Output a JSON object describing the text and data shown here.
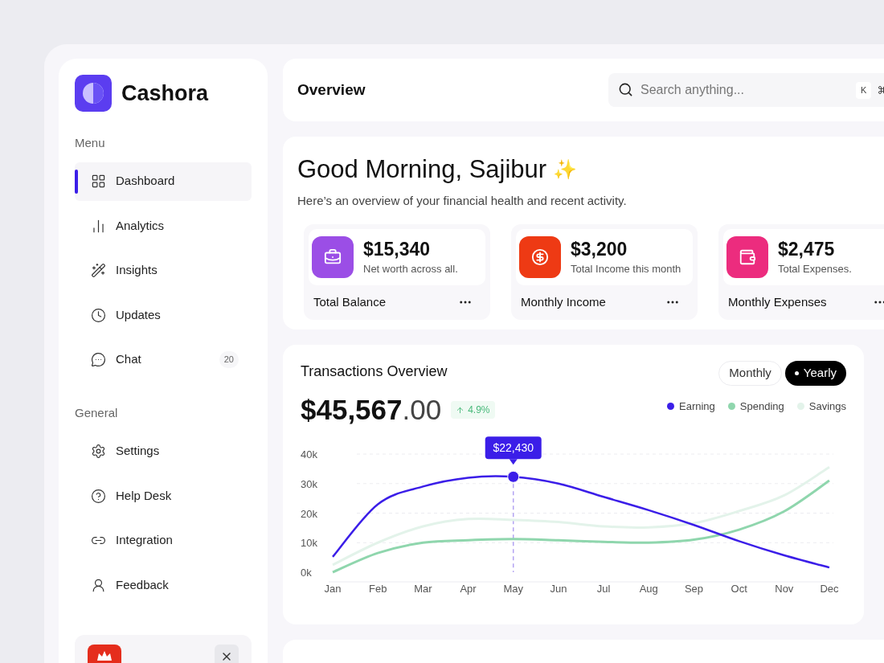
{
  "brand": {
    "name": "Cashora"
  },
  "sidebar": {
    "sections": [
      {
        "title": "Menu",
        "items": [
          {
            "label": "Dashboard",
            "selected": true
          },
          {
            "label": "Analytics",
            "selected": false
          },
          {
            "label": "Insights",
            "selected": false
          },
          {
            "label": "Updates",
            "selected": false
          },
          {
            "label": "Chat",
            "selected": false,
            "badge": "20"
          }
        ]
      },
      {
        "title": "General",
        "items": [
          {
            "label": "Settings",
            "selected": false
          },
          {
            "label": "Help Desk",
            "selected": false
          },
          {
            "label": "Integration",
            "selected": false
          },
          {
            "label": "Feedback",
            "selected": false
          }
        ]
      }
    ]
  },
  "header": {
    "title": "Overview",
    "search": {
      "placeholder": "Search anything...",
      "shortcut": "K"
    }
  },
  "greeting": {
    "title": "Good Morning, Sajibur",
    "emoji": "✨",
    "subtitle": "Here’s an overview of your financial health and recent activity."
  },
  "stats": [
    {
      "kind": "balance",
      "amount": "$15,340",
      "caption": "Net worth across all.",
      "label": "Total Balance"
    },
    {
      "kind": "income",
      "amount": "$3,200",
      "caption": "Total Income this month",
      "label": "Monthly Income"
    },
    {
      "kind": "expense",
      "amount": "$2,475",
      "caption": "Total Expenses.",
      "label": "Monthly Expenses"
    }
  ],
  "transactions": {
    "title": "Transactions Overview",
    "amount": "$45,567",
    "cents": ".00",
    "change": "4.9%",
    "periods": [
      {
        "label": "Monthly",
        "selected": false
      },
      {
        "label": "Yearly",
        "selected": true
      }
    ],
    "chart_data": {
      "type": "line",
      "grid": true,
      "x": [
        "Jan",
        "Feb",
        "Mar",
        "Apr",
        "May",
        "Jun",
        "Jul",
        "Aug",
        "Sep",
        "Oct",
        "Nov",
        "Dec"
      ],
      "yticks": [
        {
          "value": 0,
          "label": "0k"
        },
        {
          "value": 10000,
          "label": "10k"
        },
        {
          "value": 20000,
          "label": "20k"
        },
        {
          "value": 30000,
          "label": "30k"
        },
        {
          "value": 40000,
          "label": "40k"
        }
      ],
      "ylim": [
        0,
        40000
      ],
      "series": [
        {
          "name": "Earning",
          "color": "#3b1ee8",
          "values": [
            5200,
            23000,
            29000,
            32000,
            32300,
            30000,
            25500,
            21000,
            16000,
            10500,
            5700,
            1600
          ]
        },
        {
          "name": "Spending",
          "color": "#8fd6ad",
          "values": [
            0,
            6500,
            10000,
            10800,
            11200,
            10800,
            10300,
            10000,
            11000,
            14400,
            20600,
            31000
          ]
        },
        {
          "name": "Savings",
          "color": "#e3f3ea",
          "values": [
            2500,
            10000,
            15500,
            18000,
            17700,
            17000,
            15500,
            15200,
            16600,
            20700,
            26000,
            35600
          ]
        }
      ],
      "ref_lines": [
        {
          "axis": "x",
          "value": "May",
          "color": "#b3a3f2"
        }
      ],
      "annotations": [
        {
          "x": "May",
          "y": 32300,
          "text": "$22,430"
        }
      ]
    }
  }
}
